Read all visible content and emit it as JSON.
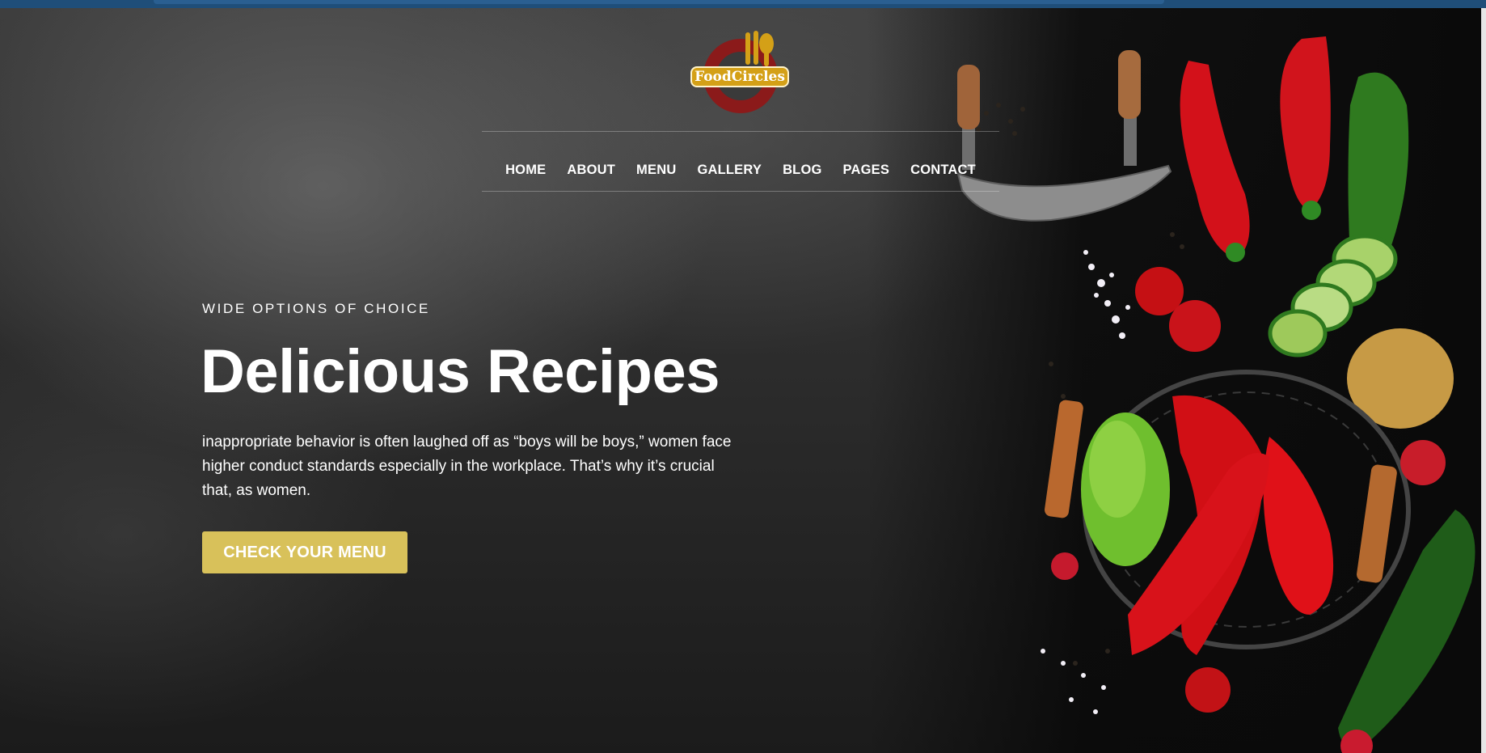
{
  "brand": {
    "name": "FoodCircles",
    "colors": {
      "gold": "#d4a017",
      "maroon": "#8b1a1a",
      "cta": "#d8c15a"
    }
  },
  "nav": {
    "items": [
      "HOME",
      "ABOUT",
      "MENU",
      "GALLERY",
      "BLOG",
      "PAGES",
      "CONTACT"
    ]
  },
  "hero": {
    "eyebrow": "WIDE OPTIONS OF CHOICE",
    "title": "Delicious Recipes",
    "description": "inappropriate behavior is often laughed off as “boys will be boys,” women face higher conduct standards especially in the workplace. That’s why it’s crucial that, as women.",
    "cta_label": "CHECK YOUR MENU"
  },
  "decor": {
    "icons": [
      "utensils-icon",
      "mezzaluna-knife-icon",
      "red-pepper-icon",
      "cucumber-icon",
      "tomato-icon",
      "potato-icon",
      "wire-basket-icon",
      "lettuce-icon",
      "radish-icon",
      "salt-icon"
    ]
  }
}
